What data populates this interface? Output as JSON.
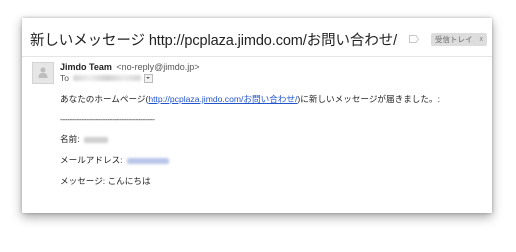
{
  "subject": "新しいメッセージ http://pcplaza.jimdo.com/お問い合わせ/",
  "label_chip": {
    "text": "受信トレイ",
    "close": "x"
  },
  "sender": {
    "name": "Jimdo Team",
    "email": "<no-reply@jimdo.jp>"
  },
  "recipient": {
    "to_label": "To"
  },
  "message": {
    "line1_prefix": "あなたのホームページ(",
    "line1_link": "http://pcplaza.jimdo.com/お問い合わせ/",
    "line1_suffix": ")に新しいメッセージが届きました。:",
    "separator": "----------------------------------------",
    "name_label": "名前:",
    "email_label": "メールアドレス:",
    "message_label": "メッセージ:",
    "message_value": "こんにちは"
  }
}
